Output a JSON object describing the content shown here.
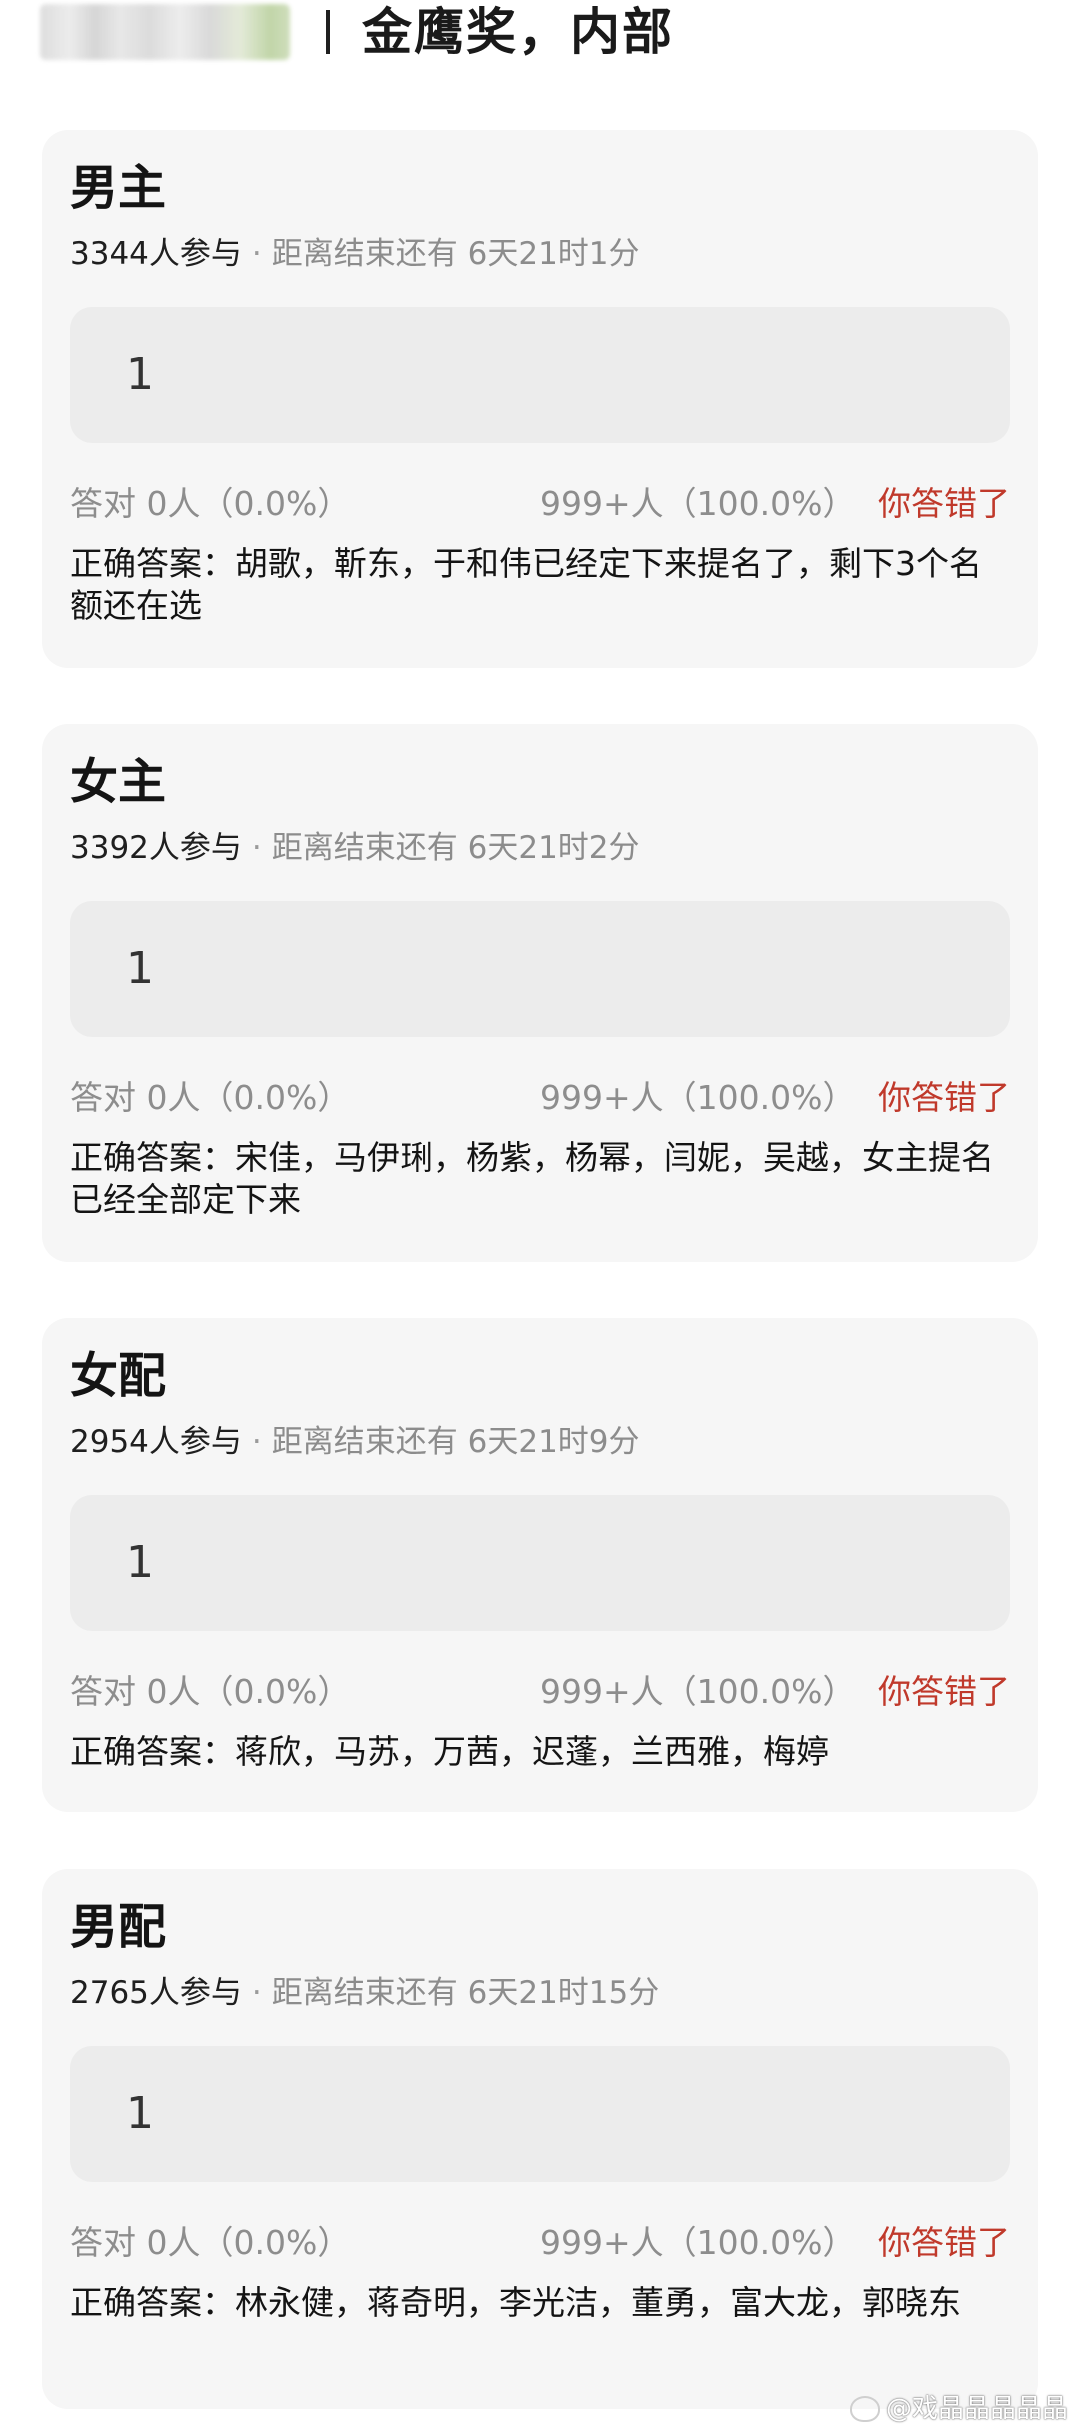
{
  "header": {
    "title": "金鹰奖，内部"
  },
  "cards": [
    {
      "title": "男主",
      "participants": "3344人参与",
      "separator": "·",
      "countdown": "距离结束还有 6天21时1分",
      "answer": "1",
      "correct_stat": "答对  0人（0.0%）",
      "wrong_stat": "999+人（100.0%）",
      "result": "你答错了",
      "correct_answer": "正确答案：胡歌，靳东，于和伟已经定下来提名了，剩下3个名额还在选"
    },
    {
      "title": "女主",
      "participants": "3392人参与",
      "separator": "·",
      "countdown": "距离结束还有 6天21时2分",
      "answer": "1",
      "correct_stat": "答对  0人（0.0%）",
      "wrong_stat": "999+人（100.0%）",
      "result": "你答错了",
      "correct_answer": "正确答案：宋佳，马伊琍，杨紫，杨幂，闫妮，吴越，女主提名已经全部定下来"
    },
    {
      "title": "女配",
      "participants": "2954人参与",
      "separator": "·",
      "countdown": "距离结束还有 6天21时9分",
      "answer": "1",
      "correct_stat": "答对  0人（0.0%）",
      "wrong_stat": "999+人（100.0%）",
      "result": "你答错了",
      "correct_answer": "正确答案：蒋欣，马苏，万茜，迟蓬，兰西雅，梅婷"
    },
    {
      "title": "男配",
      "participants": "2765人参与",
      "separator": "·",
      "countdown": "距离结束还有 6天21时15分",
      "answer": "1",
      "correct_stat": "答对  0人（0.0%）",
      "wrong_stat": "999+人（100.0%）",
      "result": "你答错了",
      "correct_answer": "正确答案：林永健，蒋奇明，李光洁，董勇，富大龙，郭晓东"
    }
  ],
  "watermark": {
    "text": "@戏晶晶晶晶晶",
    "icon": "weibo-icon"
  },
  "colors": {
    "card_bg": "#f6f6f6",
    "answer_bg": "#ececec",
    "result_red": "#c0392b",
    "muted_gray": "#8d8d8d"
  }
}
